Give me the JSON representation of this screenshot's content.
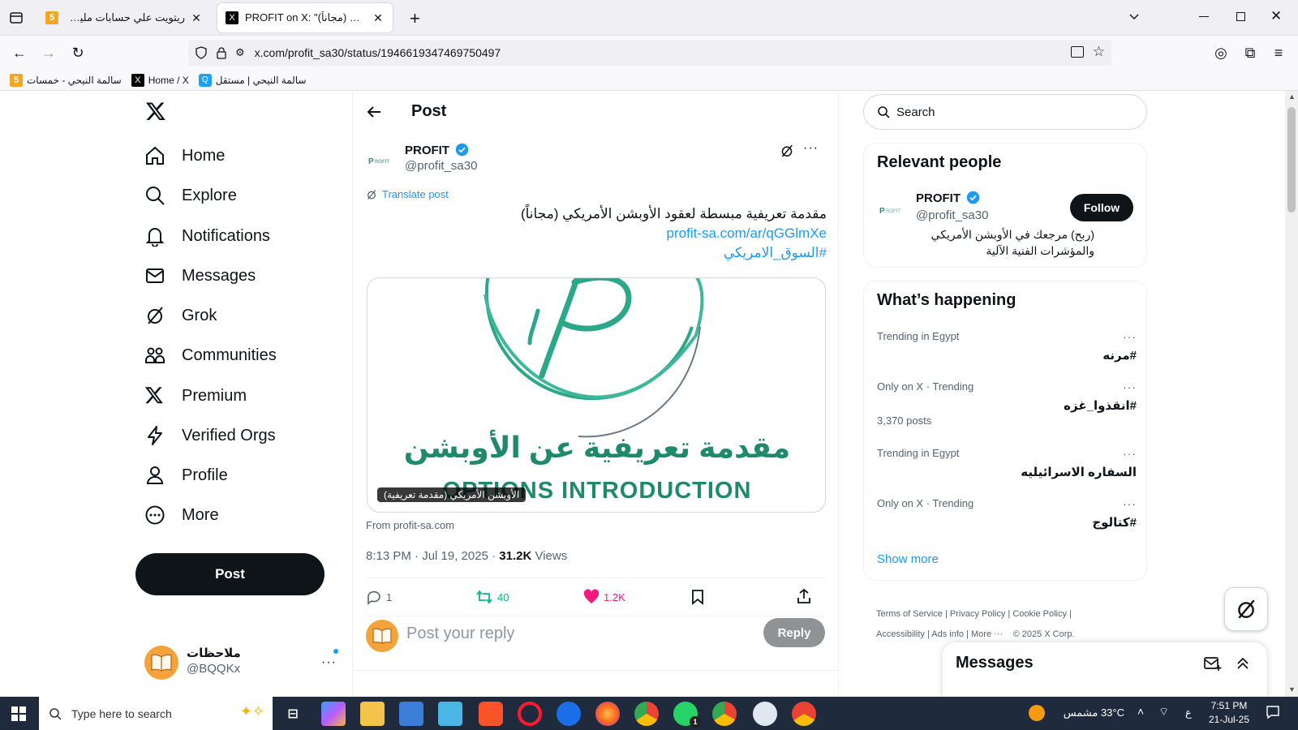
{
  "browser": {
    "tabs": [
      {
        "title": "ريتويت علي حسابات مليونية - خ",
        "favicon": "5",
        "active": false
      },
      {
        "title": "PROFIT on X: \"ن الأمريكي (مجاناً)",
        "favicon": "X",
        "active": true
      }
    ],
    "url": "x.com/profit_sa30/status/1946619347469750497",
    "bookmarks": [
      {
        "label": "سالمة النيحي - خمسات",
        "favicon": "5"
      },
      {
        "label": "Home / X",
        "favicon": "X"
      },
      {
        "label": "سالمة النيحي | مستقل",
        "favicon": "Q"
      }
    ]
  },
  "sidebar": {
    "items": [
      {
        "label": "Home",
        "icon": "home-icon"
      },
      {
        "label": "Explore",
        "icon": "search-icon"
      },
      {
        "label": "Notifications",
        "icon": "bell-icon"
      },
      {
        "label": "Messages",
        "icon": "mail-icon"
      },
      {
        "label": "Grok",
        "icon": "grok-icon"
      },
      {
        "label": "Communities",
        "icon": "communities-icon"
      },
      {
        "label": "Premium",
        "icon": "x-logo-icon"
      },
      {
        "label": "Verified Orgs",
        "icon": "lightning-icon"
      },
      {
        "label": "Profile",
        "icon": "person-icon"
      },
      {
        "label": "More",
        "icon": "more-circle-icon"
      }
    ],
    "post_label": "Post",
    "account": {
      "name": "ملاحظات",
      "handle": "@BQQKx"
    }
  },
  "post": {
    "header_title": "Post",
    "author_name": "PROFIT",
    "author_handle": "@profit_sa30",
    "translate_label": "Translate post",
    "text": "مقدمة تعريفية مبسطة لعقود الأوبشن الأمريكي (مجاناً)",
    "link": "profit-sa.com/ar/qGGlmXe",
    "hashtag": "#السوق_الامريكي",
    "card_arabic": "مقدمة تعريفية عن الأوبشن",
    "card_english": "OPTIONS INTRODUCTION",
    "card_caption": "الأوبشن الأمريكي (مقدمة تعريفية)",
    "card_source": "From profit-sa.com",
    "timestamp": "8:13 PM · Jul 19, 2025 · ",
    "views_count": "31.2K",
    "views_label": " Views",
    "stats": {
      "replies": "1",
      "reposts": "40",
      "likes": "1.2K"
    },
    "reply_placeholder": "Post your reply",
    "reply_button": "Reply"
  },
  "right": {
    "search_placeholder": "Search",
    "relevant_title": "Relevant people",
    "person": {
      "name": "PROFIT",
      "handle": "@profit_sa30",
      "bio": "(ربح) مرجعك في الأوبشن الأمريكي والمؤشرات الفنية الآلية",
      "follow_label": "Follow"
    },
    "happening_title": "What’s happening",
    "trends": [
      {
        "meta": "Trending in Egypt",
        "name": "#مرنه",
        "posts": ""
      },
      {
        "meta": "Only on X · Trending",
        "name": "#انقذوا_غزه",
        "posts": "3,370 posts"
      },
      {
        "meta": "Trending in Egypt",
        "name": "السفاره الاسرائيليه",
        "posts": ""
      },
      {
        "meta": "Only on X · Trending",
        "name": "#كتالوج",
        "posts": ""
      }
    ],
    "show_more": "Show more",
    "footer": [
      "Terms of Service",
      "Privacy Policy",
      "Cookie Policy",
      "Accessibility",
      "Ads info",
      "More ···",
      "© 2025 X Corp."
    ],
    "messages_title": "Messages"
  },
  "taskbar": {
    "search_placeholder": "Type here to search",
    "weather": "33°C  مشمس",
    "lang": "ع",
    "time": "7:51 PM",
    "date": "21-Jul-25",
    "whatsapp_badge": "1"
  }
}
